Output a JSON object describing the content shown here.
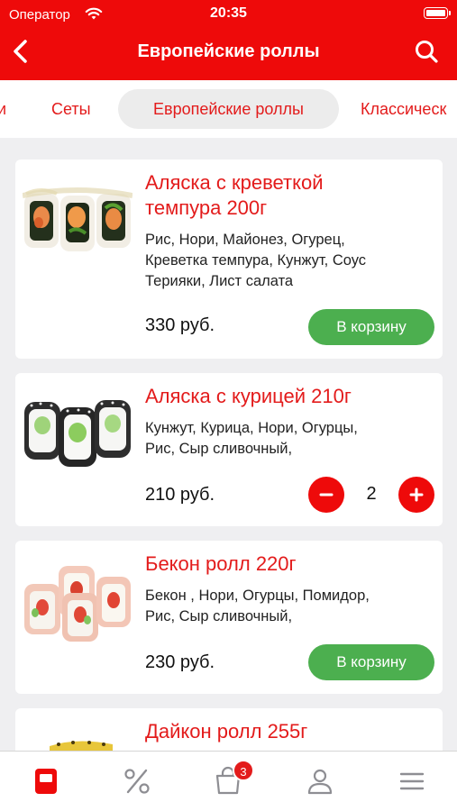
{
  "status_bar": {
    "carrier": "Оператор",
    "time": "20:35"
  },
  "nav": {
    "title": "Европейские роллы",
    "back_icon": "chevron-left-icon",
    "search_icon": "search-icon"
  },
  "tabs": [
    {
      "label": "и",
      "active": false
    },
    {
      "label": "Сеты",
      "active": false
    },
    {
      "label": "Европейские роллы",
      "active": true
    },
    {
      "label": "Классическ",
      "active": false
    }
  ],
  "products": [
    {
      "name_line1": "Аляска с креветкой",
      "name_line2": "темпура 200г",
      "desc_line1": "Рис, Нори, Майонез, Огурец,",
      "desc_line2": "Креветка темпура, Кунжут, Соус",
      "desc_line3": "Терияки, Лист салата",
      "price": "330 руб.",
      "cart_label": "В корзину"
    },
    {
      "name_line1": "Аляска с курицей 210г",
      "desc_line1": "Кунжут, Курица, Нори, Огурцы,",
      "desc_line2": "Рис, Сыр сливочный,",
      "price": "210 руб.",
      "quantity": "2"
    },
    {
      "name_line1": "Бекон ролл 220г",
      "desc_line1": "Бекон , Нори, Огурцы, Помидор,",
      "desc_line2": "Рис, Сыр сливочный,",
      "price": "230 руб.",
      "cart_label": "В корзину"
    },
    {
      "name_line1": "Дайкон ролл 255г"
    }
  ],
  "tabbar": {
    "items": [
      "menu-icon",
      "percent-icon",
      "cart-icon",
      "profile-icon",
      "hamburger-icon"
    ],
    "cart_badge": "3"
  },
  "colors": {
    "brand_red": "#ee0a0a",
    "cart_green": "#4caf4f"
  }
}
